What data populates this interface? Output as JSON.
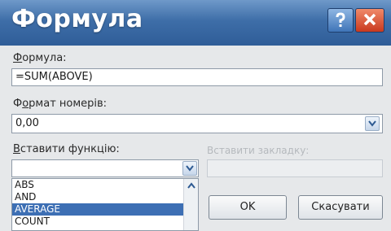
{
  "dialog": {
    "title": "Формула",
    "help_icon": "help-icon",
    "close_icon": "close-icon"
  },
  "formula": {
    "label_accel": "Ф",
    "label_rest": "ормула:",
    "value": "=SUM(ABOVE)"
  },
  "number_format": {
    "label_pre": "Ф",
    "label_accel": "о",
    "label_rest": "рмат номерів:",
    "value": "0,00"
  },
  "insert_function": {
    "label_accel": "В",
    "label_rest": "ставити функцію:",
    "value": "",
    "options": [
      "ABS",
      "AND",
      "AVERAGE",
      "COUNT"
    ],
    "selected_index": 2
  },
  "insert_bookmark": {
    "label": "Вставити закладку:"
  },
  "buttons": {
    "ok": "OK",
    "cancel": "Скасувати"
  },
  "colors": {
    "titlebar": "#3e6ea8",
    "selection": "#3d6fb4",
    "close": "#c9391f"
  }
}
